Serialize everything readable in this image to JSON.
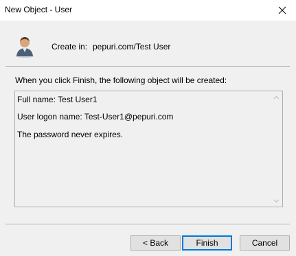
{
  "window": {
    "title": "New Object - User",
    "close_icon": "close-icon"
  },
  "header": {
    "icon": "user-icon",
    "create_in_label": "Create in:",
    "create_in_value": "pepuri.com/Test User"
  },
  "instruction": "When you click Finish, the following object will be created:",
  "summary": {
    "lines": [
      "Full name: Test User1",
      "User logon name: Test-User1@pepuri.com",
      "The password never expires."
    ]
  },
  "buttons": {
    "back": "< Back",
    "finish": "Finish",
    "cancel": "Cancel"
  },
  "colors": {
    "accent": "#0078d7",
    "window_bg": "#f0f0f0",
    "titlebar_bg": "#ffffff"
  }
}
